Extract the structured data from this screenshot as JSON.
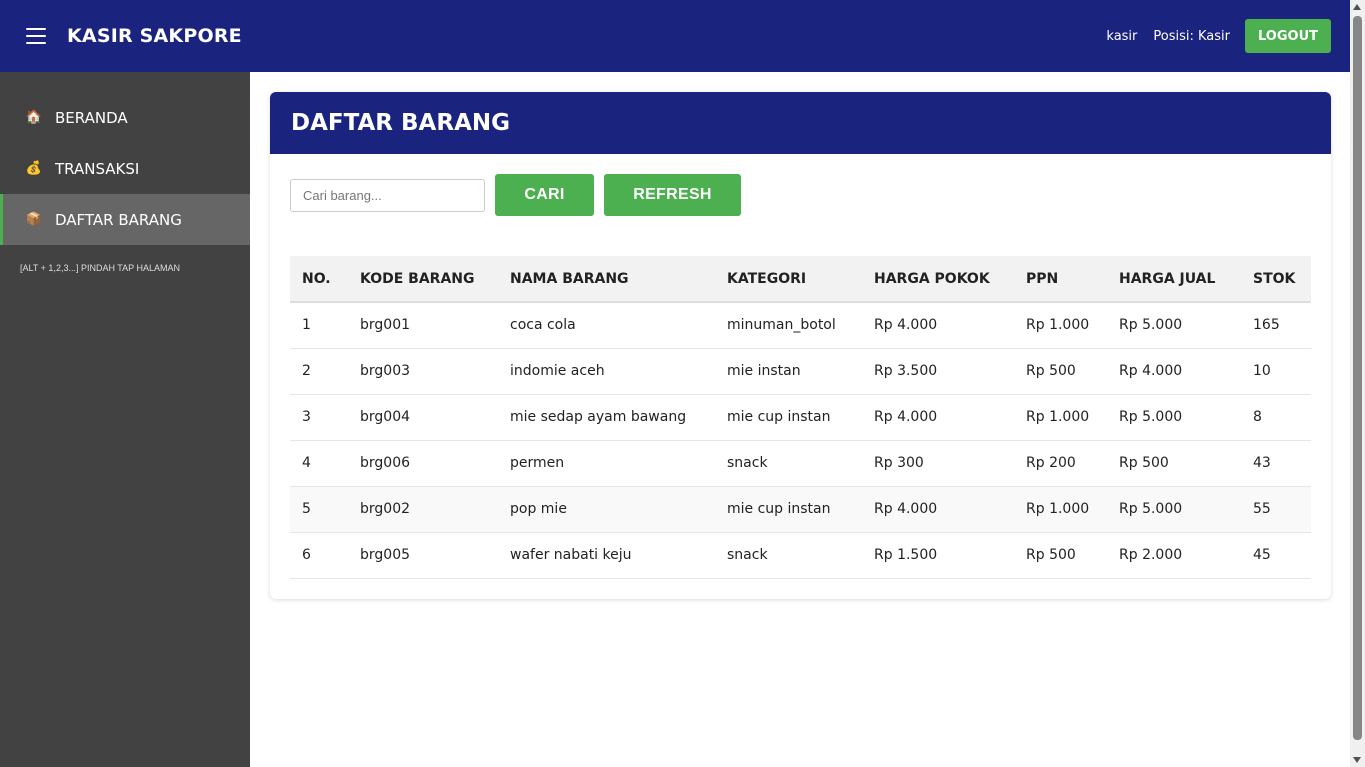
{
  "header": {
    "title": "KASIR SAKPORE",
    "user": "kasir",
    "position": "Posisi: Kasir",
    "logout_label": "LOGOUT"
  },
  "sidebar": {
    "items": [
      {
        "label": "BERANDA",
        "icon": "house-icon",
        "glyph": "🏠"
      },
      {
        "label": "TRANSAKSI",
        "icon": "money-bag-icon",
        "glyph": "💰"
      },
      {
        "label": "DAFTAR BARANG",
        "icon": "package-icon",
        "glyph": "📦"
      }
    ],
    "hint": "[ALT + 1,2,3...] PINDAH TAP HALAMAN"
  },
  "main": {
    "title": "DAFTAR BARANG",
    "search_placeholder": "Cari barang...",
    "search_value": "",
    "cari_label": "CARI",
    "refresh_label": "REFRESH",
    "table": {
      "headers": [
        "NO.",
        "KODE BARANG",
        "NAMA BARANG",
        "KATEGORI",
        "HARGA POKOK",
        "PPN",
        "HARGA JUAL",
        "STOK"
      ],
      "rows": [
        [
          "1",
          "brg001",
          "coca cola",
          "minuman_botol",
          "Rp 4.000",
          "Rp 1.000",
          "Rp 5.000",
          "165"
        ],
        [
          "2",
          "brg003",
          "indomie aceh",
          "mie instan",
          "Rp 3.500",
          "Rp 500",
          "Rp 4.000",
          "10"
        ],
        [
          "3",
          "brg004",
          "mie sedap ayam bawang",
          "mie cup instan",
          "Rp 4.000",
          "Rp 1.000",
          "Rp 5.000",
          "8"
        ],
        [
          "4",
          "brg006",
          "permen",
          "snack",
          "Rp 300",
          "Rp 200",
          "Rp 500",
          "43"
        ],
        [
          "5",
          "brg002",
          "pop mie",
          "mie cup instan",
          "Rp 4.000",
          "Rp 1.000",
          "Rp 5.000",
          "55"
        ],
        [
          "6",
          "brg005",
          "wafer nabati keju",
          "snack",
          "Rp 1.500",
          "Rp 500",
          "Rp 2.000",
          "45"
        ]
      ]
    }
  },
  "colors": {
    "primary": "#1a237e",
    "accent": "#4caf50",
    "sidebar": "#424242",
    "sidebar_active": "#666666"
  }
}
